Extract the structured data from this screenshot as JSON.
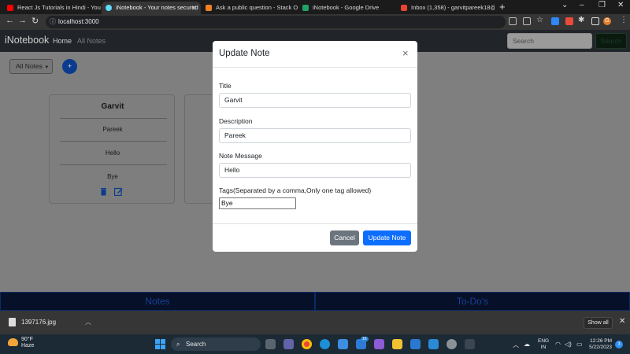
{
  "browser": {
    "tabs": [
      {
        "title": "React Js Tutorials in Hindi - YouTu",
        "favicon_color": "#ff0000"
      },
      {
        "title": "iNotebook - Your notes secured",
        "favicon_color": "#61dafb"
      },
      {
        "title": "Ask a public question - Stack Ov",
        "favicon_color": "#f48024"
      },
      {
        "title": "iNotebook - Google Drive",
        "favicon_color": "#1fa463"
      },
      {
        "title": "Inbox (1,358) - garvitpareek18@",
        "favicon_color": "#ea4335"
      }
    ],
    "url": "localhost:3000",
    "profile_initial": "G"
  },
  "app": {
    "brand": "iNotebook",
    "nav": {
      "home": "Home",
      "all_notes": "All Notes"
    },
    "search": {
      "placeholder": "Search",
      "button": "Search"
    },
    "filter_dropdown": "All Notes",
    "add_button": "+",
    "notes": [
      {
        "title": "Garvit",
        "description": "Pareek",
        "message": "Hello",
        "tag": "Bye"
      }
    ],
    "bottom_tabs": [
      "Notes",
      "To-Do's"
    ]
  },
  "modal": {
    "title": "Update Note",
    "close": "×",
    "fields": {
      "title": {
        "label": "Title",
        "value": "Garvit"
      },
      "description": {
        "label": "Description",
        "value": "Pareek"
      },
      "message": {
        "label": "Note Message",
        "value": "Hello"
      },
      "tags": {
        "label": "Tags(Separated by a comma,Only one tag allowed)",
        "value": "Bye"
      }
    },
    "cancel": "Cancel",
    "update": "Update Note"
  },
  "downloads": {
    "file": "1397176.jpg",
    "show_all": "Show all"
  },
  "taskbar": {
    "temperature": "90°F",
    "condition": "Haze",
    "search": "Search",
    "language": "ENG",
    "region": "IN",
    "time": "12:26 PM",
    "date": "5/22/2023",
    "badge": "16",
    "notifications": "3"
  }
}
